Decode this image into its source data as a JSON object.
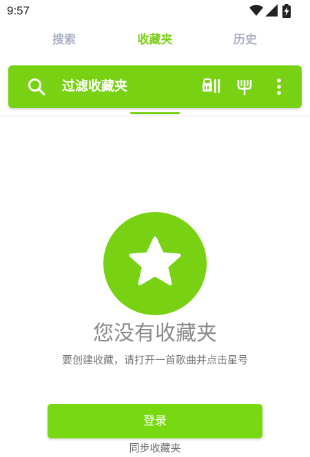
{
  "status_bar": {
    "time": "9:57",
    "icons": [
      "wifi-icon",
      "signal-icon",
      "battery-charging-icon"
    ]
  },
  "tabs": [
    {
      "label": "搜索",
      "active": false
    },
    {
      "label": "收藏夹",
      "active": true
    },
    {
      "label": "历史",
      "active": false
    }
  ],
  "toolbar": {
    "filter_label": "过滤收藏夹",
    "icons": [
      "search-icon",
      "sort-icon",
      "filter-icon",
      "more-vert-icon"
    ]
  },
  "empty_state": {
    "icon": "star-icon",
    "title": "您没有收藏夹",
    "hint": "要创建收藏，请打开一首歌曲并点击星号"
  },
  "login": {
    "button_label": "登录",
    "sync_label": "同步收藏夹"
  },
  "colors": {
    "accent": "#78d213",
    "inactive_tab": "#aab1c4"
  }
}
